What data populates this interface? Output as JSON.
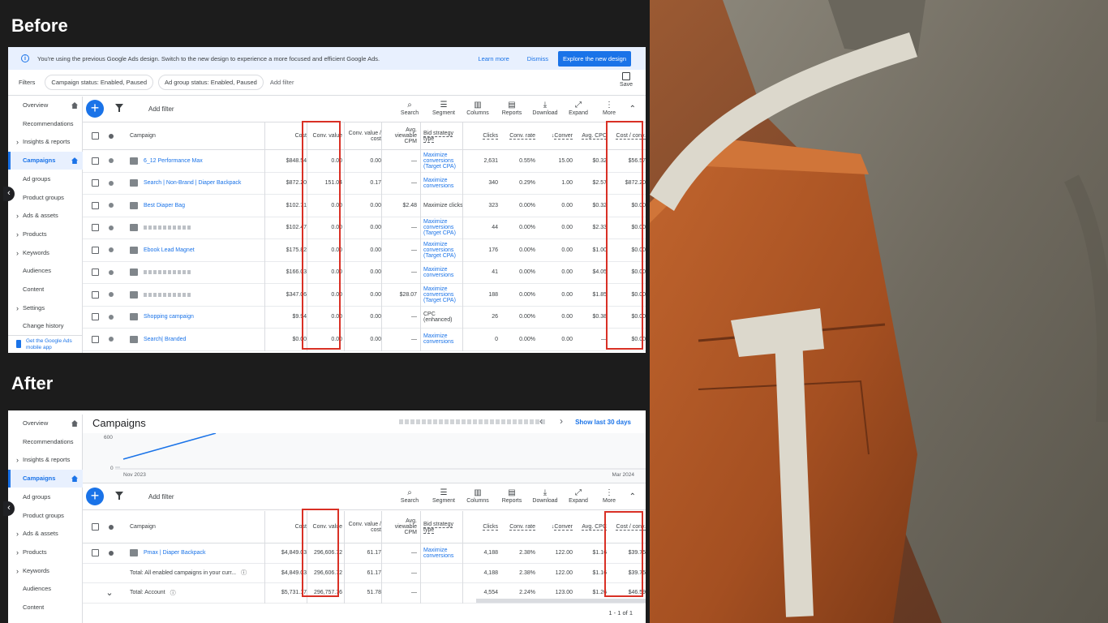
{
  "labels": {
    "before": "Before",
    "after": "After"
  },
  "banner": {
    "message": "You're using the previous Google Ads design. Switch to the new design to experience a more focused and efficient Google Ads.",
    "learn_more": "Learn more",
    "dismiss": "Dismiss",
    "explore": "Explore the new design"
  },
  "filters": {
    "label": "Filters",
    "chips": [
      "Campaign status: Enabled, Paused",
      "Ad group status: Enabled, Paused"
    ],
    "add": "Add filter",
    "save": "Save"
  },
  "sidebar_before": [
    "Overview",
    "Recommendations",
    "Insights & reports",
    "Campaigns",
    "Ad groups",
    "Product groups",
    "Ads & assets",
    "Products",
    "Keywords",
    "Audiences",
    "Content",
    "Settings",
    "Change history"
  ],
  "sidebar_after": [
    "Overview",
    "Recommendations",
    "Insights & reports",
    "Campaigns",
    "Ad groups",
    "Product groups",
    "Ads & assets",
    "Products",
    "Keywords",
    "Audiences",
    "Content"
  ],
  "mobile_app": "Get the Google Ads mobile app",
  "toolbar": {
    "add_filter": "Add filter",
    "buttons": [
      "Search",
      "Segment",
      "Columns",
      "Reports",
      "Download",
      "Expand",
      "More"
    ],
    "plus": "+"
  },
  "columns": {
    "campaign": "Campaign",
    "cost": "Cost",
    "conv_value": "Conv. value",
    "conv_value_cost": "Conv. value / cost",
    "avg_cpm": "Avg. viewable CPM",
    "bid": "Bid strategy type",
    "clicks": "Clicks",
    "conv_rate": "Conv. rate",
    "conversions": "Conver",
    "avg_cpc": "Avg. CPC",
    "cost_conv": "Cost / conv."
  },
  "before_rows": [
    {
      "name": "6_12 Performance Max",
      "cost": "$848.54",
      "cv": "0.00",
      "cvc": "0.00",
      "cpm": "—",
      "bid": "Maximize conversions (Target CPA)",
      "clicks": "2,631",
      "rate": "0.55%",
      "conv": "15.00",
      "cpc": "$0.32",
      "cc": "$56.57"
    },
    {
      "name": "Search | Non-Brand | Diaper Backpack",
      "cost": "$872.20",
      "cv": "151.04",
      "cvc": "0.17",
      "cpm": "—",
      "bid": "Maximize conversions",
      "clicks": "340",
      "rate": "0.29%",
      "conv": "1.00",
      "cpc": "$2.57",
      "cc": "$872.20"
    },
    {
      "name": "Best Diaper Bag",
      "cost": "$102.71",
      "cv": "0.00",
      "cvc": "0.00",
      "cpm": "$2.48",
      "bid": "Maximize clicks",
      "clicks": "323",
      "rate": "0.00%",
      "conv": "0.00",
      "cpc": "$0.32",
      "cc": "$0.00"
    },
    {
      "name": "",
      "cost": "$102.47",
      "cv": "0.00",
      "cvc": "0.00",
      "cpm": "—",
      "bid": "Maximize conversions (Target CPA)",
      "clicks": "44",
      "rate": "0.00%",
      "conv": "0.00",
      "cpc": "$2.33",
      "cc": "$0.00"
    },
    {
      "name": "Ebook Lead Magnet",
      "cost": "$175.82",
      "cv": "0.00",
      "cvc": "0.00",
      "cpm": "—",
      "bid": "Maximize conversions (Target CPA)",
      "clicks": "176",
      "rate": "0.00%",
      "conv": "0.00",
      "cpc": "$1.00",
      "cc": "$0.00"
    },
    {
      "name": "",
      "cost": "$166.03",
      "cv": "0.00",
      "cvc": "0.00",
      "cpm": "—",
      "bid": "Maximize conversions",
      "clicks": "41",
      "rate": "0.00%",
      "conv": "0.00",
      "cpc": "$4.05",
      "cc": "$0.00"
    },
    {
      "name": "",
      "cost": "$347.06",
      "cv": "0.00",
      "cvc": "0.00",
      "cpm": "$28.07",
      "bid": "Maximize conversions (Target CPA)",
      "clicks": "188",
      "rate": "0.00%",
      "conv": "0.00",
      "cpc": "$1.85",
      "cc": "$0.00"
    },
    {
      "name": "Shopping campaign",
      "cost": "$9.94",
      "cv": "0.00",
      "cvc": "0.00",
      "cpm": "—",
      "bid": "CPC (enhanced)",
      "clicks": "26",
      "rate": "0.00%",
      "conv": "0.00",
      "cpc": "$0.38",
      "cc": "$0.00"
    },
    {
      "name": "Search| Branded",
      "cost": "$0.00",
      "cv": "0.00",
      "cvc": "0.00",
      "cpm": "—",
      "bid": "Maximize conversions",
      "clicks": "0",
      "rate": "0.00%",
      "conv": "0.00",
      "cpc": "—",
      "cc": "$0.00"
    }
  ],
  "after": {
    "title": "Campaigns",
    "show_last": "Show last 30 days",
    "chart": {
      "y_top": "600",
      "y_bottom": "0",
      "x_start": "Nov 2023",
      "x_end": "Mar 2024"
    },
    "rows": [
      {
        "name": "Pmax | Diaper Backpack",
        "cost": "$4,849.03",
        "cv": "296,606.72",
        "cvc": "61.17",
        "cpm": "—",
        "bid": "Maximize conversions",
        "clicks": "4,188",
        "rate": "2.38%",
        "conv": "122.00",
        "cpc": "$1.16",
        "cc": "$39.75"
      },
      {
        "name": "Total: All enabled campaigns in your curr...",
        "cost": "$4,849.03",
        "cv": "296,606.72",
        "cvc": "61.17",
        "cpm": "—",
        "bid": "",
        "clicks": "4,188",
        "rate": "2.38%",
        "conv": "122.00",
        "cpc": "$1.16",
        "cc": "$39.75"
      },
      {
        "name": "Total: Account",
        "cost": "$5,731.17",
        "cv": "296,757.76",
        "cvc": "51.78",
        "cpm": "—",
        "bid": "",
        "clicks": "4,554",
        "rate": "2.24%",
        "conv": "123.00",
        "cpc": "$1.26",
        "cc": "$46.59"
      }
    ],
    "pager": "1 - 1 of 1"
  }
}
